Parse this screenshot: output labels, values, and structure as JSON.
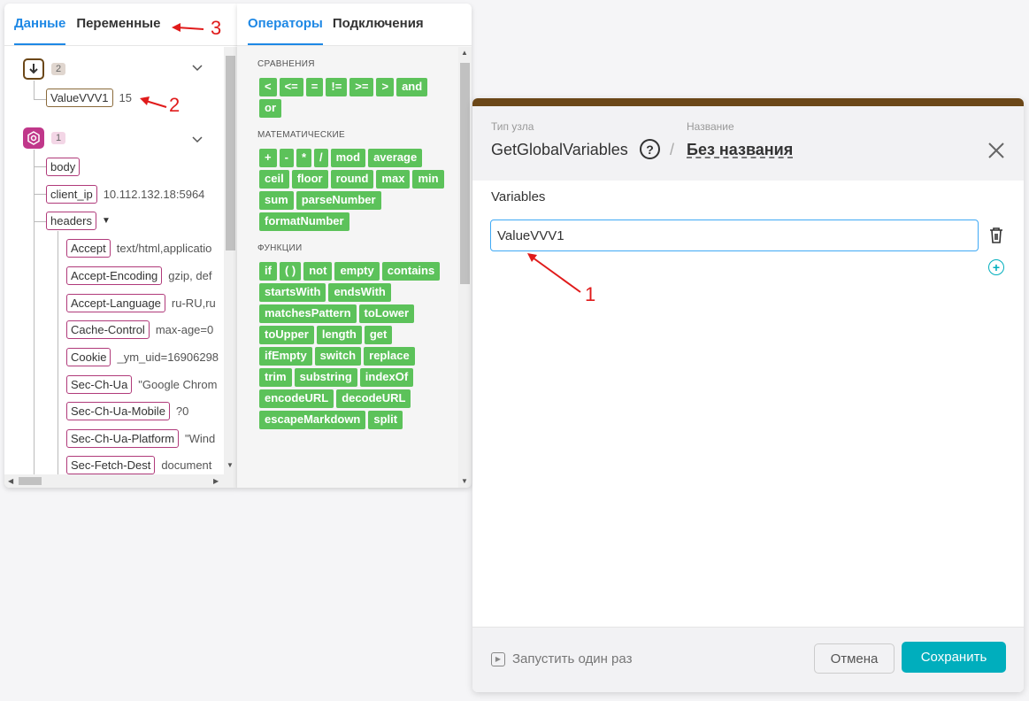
{
  "data_panel": {
    "tabs": [
      {
        "label": "Данные",
        "active": true
      },
      {
        "label": "Переменные",
        "active": false
      }
    ],
    "global_node": {
      "badge": "2",
      "variable_name": "ValueVVV1",
      "variable_value": "15"
    },
    "request_node": {
      "badge": "1"
    },
    "fields": [
      {
        "name": "body",
        "value": ""
      },
      {
        "name": "client_ip",
        "value": "10.112.132.18:5964"
      },
      {
        "name": "headers",
        "value": ""
      }
    ],
    "headers": [
      {
        "name": "Accept",
        "value": "text/html,applicatio"
      },
      {
        "name": "Accept-Encoding",
        "value": "gzip, def"
      },
      {
        "name": "Accept-Language",
        "value": "ru-RU,ru"
      },
      {
        "name": "Cache-Control",
        "value": "max-age=0"
      },
      {
        "name": "Cookie",
        "value": "_ym_uid=16906298"
      },
      {
        "name": "Sec-Ch-Ua",
        "value": "\"Google Chrom"
      },
      {
        "name": "Sec-Ch-Ua-Mobile",
        "value": "?0"
      },
      {
        "name": "Sec-Ch-Ua-Platform",
        "value": "\"Wind"
      },
      {
        "name": "Sec-Fetch-Dest",
        "value": "document"
      }
    ]
  },
  "operators_panel": {
    "tabs": [
      {
        "label": "Операторы",
        "active": true
      },
      {
        "label": "Подключения",
        "active": false
      }
    ],
    "sections": [
      {
        "title": "СРАВНЕНИЯ",
        "items": [
          "<",
          "<=",
          "=",
          "!=",
          ">=",
          ">",
          "and",
          "or"
        ]
      },
      {
        "title": "МАТЕМАТИЧЕСКИЕ",
        "items": [
          "+",
          "-",
          "*",
          "/",
          "mod",
          "average",
          "ceil",
          "floor",
          "round",
          "max",
          "min",
          "sum",
          "parseNumber",
          "formatNumber"
        ]
      },
      {
        "title": "ФУНКЦИИ",
        "items": [
          "if",
          "( )",
          "not",
          "empty",
          "contains",
          "startsWith",
          "endsWith",
          "matchesPattern",
          "toLower",
          "toUpper",
          "length",
          "get",
          "ifEmpty",
          "switch",
          "replace",
          "trim",
          "substring",
          "indexOf",
          "encodeURL",
          "decodeURL",
          "escapeMarkdown",
          "split"
        ]
      }
    ]
  },
  "dialog": {
    "node_type_label": "Тип узла",
    "node_type_value": "GetGlobalVariables",
    "name_label": "Название",
    "name_value": "Без названия",
    "variables_label": "Variables",
    "variable_input_value": "ValueVVV1",
    "run_once_label": "Запустить один раз",
    "cancel_label": "Отмена",
    "save_label": "Сохранить"
  },
  "annotations": {
    "one": "1",
    "two": "2",
    "three": "3"
  },
  "colors": {
    "accent": "#1e88e5",
    "operator": "#5cc25a",
    "primary_button": "#00aebd",
    "annotation": "#e01b1b",
    "node_bar": "#6b4718"
  }
}
